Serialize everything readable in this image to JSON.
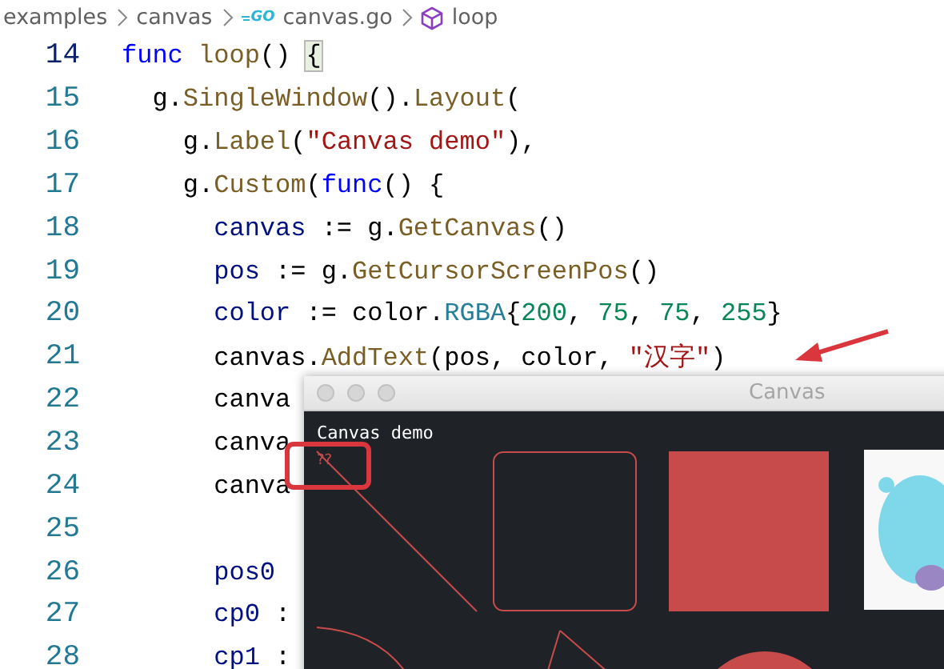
{
  "breadcrumb": [
    {
      "label": "examples",
      "kind": "folder"
    },
    {
      "label": "canvas",
      "kind": "folder"
    },
    {
      "label": "canvas.go",
      "kind": "file",
      "badge": "GO"
    },
    {
      "label": "loop",
      "kind": "symbol"
    }
  ],
  "editor": {
    "lines": [
      {
        "number": "14",
        "current": true,
        "tokens": [
          {
            "text": "func",
            "kind": "keyword"
          },
          {
            "text": " loop",
            "kind": "func"
          },
          {
            "text": "() ",
            "kind": "plain"
          },
          {
            "text": "{",
            "kind": "bracket_match"
          }
        ]
      },
      {
        "number": "15",
        "current": false,
        "tokens": [
          {
            "text": "  g.",
            "kind": "plain"
          },
          {
            "text": "SingleWindow",
            "kind": "func"
          },
          {
            "text": "().",
            "kind": "plain"
          },
          {
            "text": "Layout",
            "kind": "func"
          },
          {
            "text": "(",
            "kind": "plain"
          }
        ]
      },
      {
        "number": "16",
        "current": false,
        "tokens": [
          {
            "text": "    g.",
            "kind": "plain"
          },
          {
            "text": "Label",
            "kind": "func"
          },
          {
            "text": "(",
            "kind": "plain"
          },
          {
            "text": "\"Canvas demo\"",
            "kind": "string"
          },
          {
            "text": "),",
            "kind": "plain"
          }
        ]
      },
      {
        "number": "17",
        "current": false,
        "tokens": [
          {
            "text": "    g.",
            "kind": "plain"
          },
          {
            "text": "Custom",
            "kind": "func"
          },
          {
            "text": "(",
            "kind": "plain"
          },
          {
            "text": "func",
            "kind": "keyword"
          },
          {
            "text": "() {",
            "kind": "plain"
          }
        ]
      },
      {
        "number": "18",
        "current": false,
        "tokens": [
          {
            "text": "      canvas",
            "kind": "var"
          },
          {
            "text": " := g.",
            "kind": "plain"
          },
          {
            "text": "GetCanvas",
            "kind": "func"
          },
          {
            "text": "()",
            "kind": "plain"
          }
        ]
      },
      {
        "number": "19",
        "current": false,
        "tokens": [
          {
            "text": "      pos",
            "kind": "var"
          },
          {
            "text": " := g.",
            "kind": "plain"
          },
          {
            "text": "GetCursorScreenPos",
            "kind": "func"
          },
          {
            "text": "()",
            "kind": "plain"
          }
        ]
      },
      {
        "number": "20",
        "current": false,
        "tokens": [
          {
            "text": "      color",
            "kind": "var"
          },
          {
            "text": " := color.",
            "kind": "plain"
          },
          {
            "text": "RGBA",
            "kind": "type"
          },
          {
            "text": "{",
            "kind": "plain"
          },
          {
            "text": "200",
            "kind": "number"
          },
          {
            "text": ", ",
            "kind": "plain"
          },
          {
            "text": "75",
            "kind": "number"
          },
          {
            "text": ", ",
            "kind": "plain"
          },
          {
            "text": "75",
            "kind": "number"
          },
          {
            "text": ", ",
            "kind": "plain"
          },
          {
            "text": "255",
            "kind": "number"
          },
          {
            "text": "}",
            "kind": "plain"
          }
        ]
      },
      {
        "number": "21",
        "current": false,
        "tokens": [
          {
            "text": "      canvas.",
            "kind": "plain"
          },
          {
            "text": "AddText",
            "kind": "func"
          },
          {
            "text": "(pos, color, ",
            "kind": "plain"
          },
          {
            "text": "\"汉字\"",
            "kind": "string"
          },
          {
            "text": ")",
            "kind": "plain"
          }
        ]
      },
      {
        "number": "22",
        "current": false,
        "tokens": [
          {
            "text": "      canva",
            "kind": "plain"
          }
        ]
      },
      {
        "number": "23",
        "current": false,
        "tokens": [
          {
            "text": "      canva",
            "kind": "plain"
          }
        ]
      },
      {
        "number": "24",
        "current": false,
        "tokens": [
          {
            "text": "      canva",
            "kind": "plain"
          }
        ]
      },
      {
        "number": "25",
        "current": false
      },
      {
        "number": "26",
        "current": false,
        "tokens": [
          {
            "text": "      pos0",
            "kind": "var"
          }
        ]
      },
      {
        "number": "27",
        "current": false,
        "tokens": [
          {
            "text": "      cp0",
            "kind": "var"
          },
          {
            "text": " :",
            "kind": "plain"
          }
        ]
      },
      {
        "number": "28",
        "current": false,
        "tokens": [
          {
            "text": "      cp1",
            "kind": "var"
          },
          {
            "text": " :",
            "kind": "plain"
          }
        ]
      }
    ]
  },
  "canvas_window": {
    "title": "Canvas",
    "label": "Canvas demo",
    "drawn_text": "??"
  }
}
